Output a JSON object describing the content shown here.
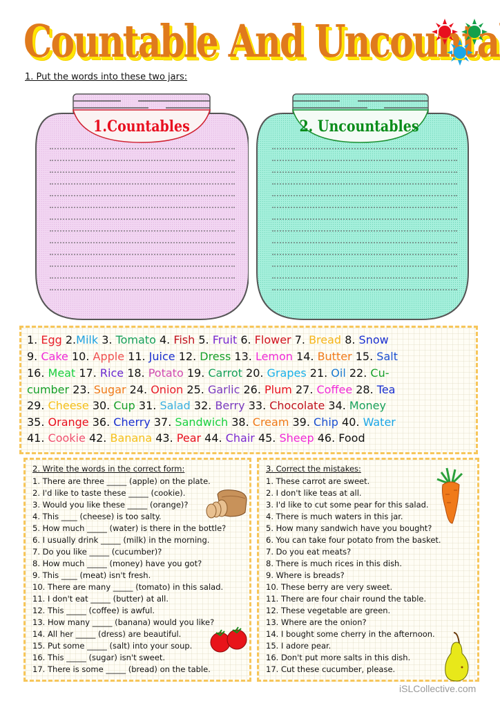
{
  "title": "Countable And Uncountable Nouns",
  "colors": {
    "title_fill": "#e07a1c",
    "title_shadow": "#ffe600",
    "sun_red": "#e8101e",
    "sun_green": "#14a04a",
    "sun_blue": "#1aa6e8",
    "jar1_fill": "#f2d6f2",
    "jar1_label": "#e81020",
    "jar2_fill": "#9ef0d8",
    "jar2_label": "#0a8c1a",
    "box_border": "#f7c65a"
  },
  "task1": {
    "instruction": "1. Put the words into these two jars:",
    "jars": [
      {
        "label": "1.Countables"
      },
      {
        "label": "2. Uncountables"
      }
    ]
  },
  "word_bank": {
    "lines": [
      [
        {
          "n": "1. ",
          "w": "Egg",
          "c": "#e81e2a"
        },
        {
          "n": "2.",
          "w": "Milk",
          "c": "#1ea0e0"
        },
        {
          "n": "3. ",
          "w": "Tomato",
          "c": "#17a05a"
        },
        {
          "n": "4. ",
          "w": "Fish",
          "c": "#c0121e"
        },
        {
          "n": "5. ",
          "w": "Fruit",
          "c": "#7a2bd0"
        },
        {
          "n": "6. ",
          "w": "Flower",
          "c": "#d0121e"
        },
        {
          "n": "7. ",
          "w": "Bread",
          "c": "#f5b51a"
        },
        {
          "n": "8. ",
          "w": "Snow",
          "c": "#1a2fd0"
        }
      ],
      [
        {
          "n": "9. ",
          "w": "Cake",
          "c": "#f02ad8"
        },
        {
          "n": "10. ",
          "w": "Apple",
          "c": "#f05050"
        },
        {
          "n": "11. ",
          "w": "Juice",
          "c": "#1a2fd0"
        },
        {
          "n": "12. ",
          "w": "Dress",
          "c": "#17a02a"
        },
        {
          "n": "13. ",
          "w": "Lemon",
          "c": "#f02ad8"
        },
        {
          "n": "14. ",
          "w": "Butter",
          "c": "#f07a1a"
        },
        {
          "n": "15. ",
          "w": "Salt",
          "c": "#1a4fd0"
        }
      ],
      [
        {
          "n": "16. ",
          "w": "Meat",
          "c": "#1ad040"
        },
        {
          "n": "17. ",
          "w": "Rice",
          "c": "#6a2ad0"
        },
        {
          "n": "18. ",
          "w": "Potato",
          "c": "#d04ab0"
        },
        {
          "n": "19. ",
          "w": "Carrot",
          "c": "#17a05a"
        },
        {
          "n": "20. ",
          "w": "Grapes",
          "c": "#1ab0e8"
        },
        {
          "n": "21. ",
          "w": "Oil",
          "c": "#1a7ad0"
        },
        {
          "n": "22. ",
          "w": "Cu-",
          "c": "#17a02a"
        }
      ],
      [
        {
          "n": "",
          "w": "cumber",
          "c": "#17a02a"
        },
        {
          "n": "23. ",
          "w": "Sugar",
          "c": "#f07a1a"
        },
        {
          "n": "24. ",
          "w": "Onion",
          "c": "#e81e2a"
        },
        {
          "n": "25. ",
          "w": "Garlic",
          "c": "#7a3ac0"
        },
        {
          "n": "26. ",
          "w": "Plum",
          "c": "#e8101e"
        },
        {
          "n": "27. ",
          "w": "Coffee",
          "c": "#f02ad8"
        },
        {
          "n": "28. ",
          "w": "Tea",
          "c": "#1a2fd0"
        }
      ],
      [
        {
          "n": "29. ",
          "w": "Cheese",
          "c": "#f5c01a"
        },
        {
          "n": "30. ",
          "w": "Cup",
          "c": "#17a02a"
        },
        {
          "n": "31. ",
          "w": "Salad",
          "c": "#3ab0e0"
        },
        {
          "n": "32. ",
          "w": "Berry",
          "c": "#7a3ac0"
        },
        {
          "n": "33. ",
          "w": "Chocolate",
          "c": "#c0121e"
        },
        {
          "n": "34. ",
          "w": "Money",
          "c": "#17a05a"
        }
      ],
      [
        {
          "n": "35. ",
          "w": "Orange",
          "c": "#e8101e"
        },
        {
          "n": "36. ",
          "w": "Cherry",
          "c": "#1a2fd0"
        },
        {
          "n": "37. ",
          "w": "Sandwich",
          "c": "#1ad040"
        },
        {
          "n": "38. ",
          "w": "Cream",
          "c": "#f07a1a"
        },
        {
          "n": "39. ",
          "w": "Chip",
          "c": "#1a4fd0"
        },
        {
          "n": "40. ",
          "w": "Water",
          "c": "#1aa6e8"
        }
      ],
      [
        {
          "n": "41. ",
          "w": "Cookie",
          "c": "#f05070"
        },
        {
          "n": "42. ",
          "w": "Banana",
          "c": "#f5c01a"
        },
        {
          "n": "43. ",
          "w": "Pear",
          "c": "#e8101e"
        },
        {
          "n": "44. ",
          "w": "Chair",
          "c": "#7a2ad0"
        },
        {
          "n": "45. ",
          "w": "Sheep",
          "c": "#f02ad8"
        },
        {
          "n": "46. ",
          "w": "Food",
          "c": "#111111"
        }
      ]
    ]
  },
  "task2": {
    "heading": "2. Write the words in the correct form:",
    "items": [
      "1. There are three _____ (apple) on the plate.",
      "2. I'd like to taste these _____ (cookie).",
      "3. Would you like these _____ (orange)?",
      "4. This ____ (cheese) is too salty.",
      "5. How much _____ (water) is there in the bottle?",
      "6. I usually drink _____ (milk) in the morning.",
      "7. Do you like _____ (cucumber)?",
      "8. How much _____ (money) have you got?",
      "9. This ____ (meat) isn't fresh.",
      "10. There are many _____ (tomato) in this salad.",
      "11. I don't eat _____ (butter) at all.",
      "12. This _____ (coffee) is awful.",
      "13. How many _____ (banana) would you like?",
      "14. All her _____ (dress) are beautiful.",
      "15. Put some _____ (salt) into your soup.",
      "16. This _____ (sugar) isn't sweet.",
      "17. There is some _____ (bread) on the table."
    ]
  },
  "task3": {
    "heading": "3. Correct the mistakes:",
    "items": [
      "1. These carrot are sweet.",
      "2. I don't like teas at all.",
      "3. I'd like to cut some pear for this salad.",
      "4. There is much waters in this jar.",
      "5. How many sandwich have you bought?",
      "6. You can take four potato from the basket.",
      "7. Do you eat meats?",
      "8. There is much rices in this dish.",
      "9. Where is breads?",
      "10. These berry are very sweet.",
      "11. There are four chair round the table.",
      "12. These vegetable are green.",
      "13. Where are the onion?",
      "14. I bought some cherry in the afternoon.",
      "15. I adore pear.",
      "16. Don't put more salts in this dish.",
      "17. Cut these cucumber, please."
    ]
  },
  "illustrations": [
    "bread-loaf",
    "tomatoes",
    "carrot",
    "pear",
    "three-suns"
  ],
  "watermark": "iSLCollective.com"
}
